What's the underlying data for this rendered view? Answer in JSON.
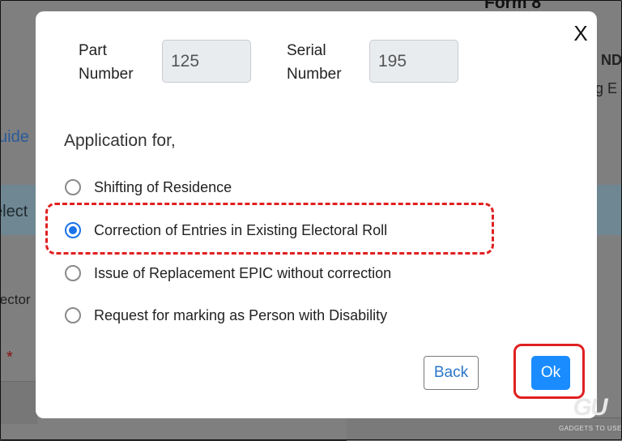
{
  "background": {
    "guide_text": "uide",
    "select_text": "elect",
    "elector_text": "lector",
    "required_star": "*",
    "form_title": "Form 8",
    "ind_text": "NDI",
    "ge_text": "g E"
  },
  "modal": {
    "close_label": "X",
    "part_number": {
      "label_line1": "Part",
      "label_line2": "Number",
      "value": "125"
    },
    "serial_number": {
      "label_line1": "Serial",
      "label_line2": "Number",
      "value": "195"
    },
    "application_for_label": "Application for,",
    "options": [
      {
        "label": "Shifting of Residence",
        "checked": false
      },
      {
        "label": "Correction of Entries in Existing Electoral Roll",
        "checked": true
      },
      {
        "label": "Issue of Replacement EPIC without correction",
        "checked": false
      },
      {
        "label": "Request for marking as Person with Disability",
        "checked": false
      }
    ],
    "back_label": "Back",
    "ok_label": "Ok"
  },
  "watermark": {
    "logo_text": "GU",
    "text": "GADGETS TO USE"
  },
  "colors": {
    "accent": "#1a73e8",
    "primary_button": "#1a8cff",
    "highlight": "#e02020"
  }
}
